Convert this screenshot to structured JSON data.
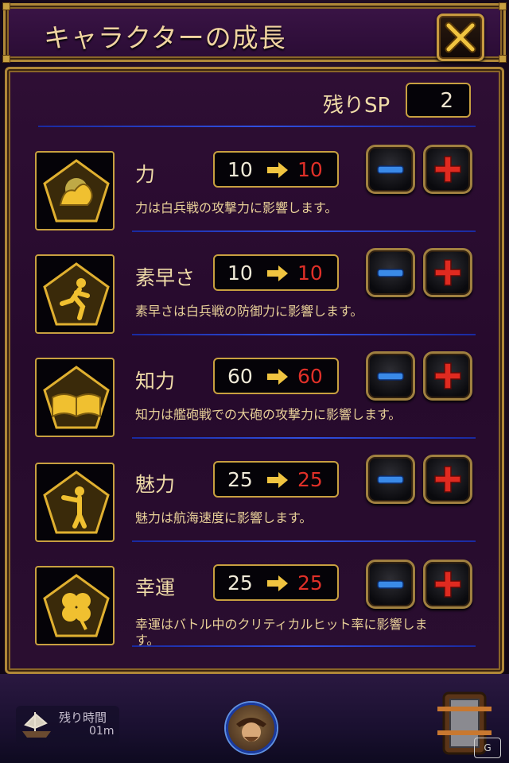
{
  "header": {
    "title": "キャラクターの成長"
  },
  "sp": {
    "label": "残りSP",
    "value": "2"
  },
  "stats": [
    {
      "name": "力",
      "current": "10",
      "next": "10",
      "description": "力は白兵戦の攻撃力に影響します。",
      "icon": "strength-icon"
    },
    {
      "name": "素早さ",
      "current": "10",
      "next": "10",
      "description": "素早さは白兵戦の防御力に影響します。",
      "icon": "agility-icon"
    },
    {
      "name": "知力",
      "current": "60",
      "next": "60",
      "description": "知力は艦砲戦での大砲の攻撃力に影響します。",
      "icon": "intellect-book-icon"
    },
    {
      "name": "魅力",
      "current": "25",
      "next": "25",
      "description": "魅力は航海速度に影響します。",
      "icon": "charm-icon"
    },
    {
      "name": "幸運",
      "current": "25",
      "next": "25",
      "description_line1": "幸運はバトル中のクリティカルヒット率に影響しま",
      "description_line2": "す。",
      "icon": "clover-icon"
    }
  ],
  "hud": {
    "timer_label": "残り時間",
    "timer_value": "01m"
  },
  "colors": {
    "frame_gold": "#c8a040",
    "panel_purple": "#2a0c34",
    "new_value_red": "#e03028",
    "divider_blue": "#3050e0"
  }
}
